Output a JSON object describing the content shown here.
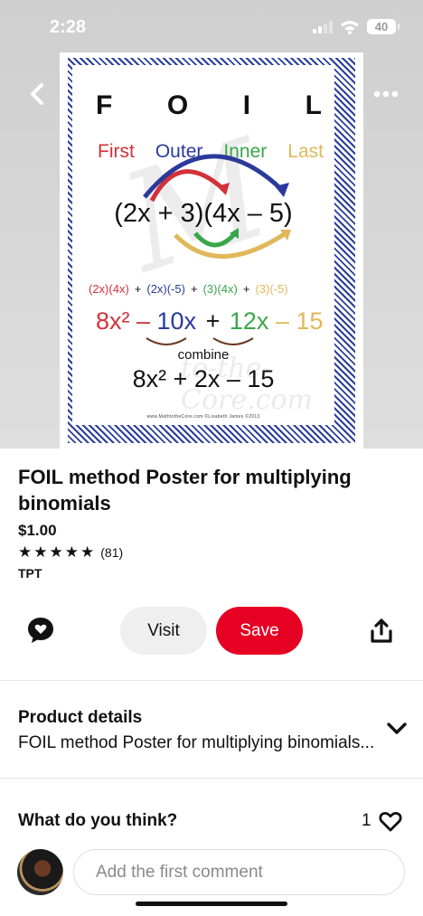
{
  "status_bar": {
    "time": "2:28",
    "battery": "40"
  },
  "poster": {
    "letters": [
      "F",
      "O",
      "I",
      "L"
    ],
    "words": [
      "First",
      "Outer",
      "Inner",
      "Last"
    ],
    "expression": "(2x + 3)(4x – 5)",
    "expansion": [
      "(2x)(4x)",
      "+",
      "(2x)(-5)",
      "+",
      "(3)(4x)",
      "+",
      "(3)(-5)"
    ],
    "terms": [
      "8x² – ",
      "10x",
      " + ",
      "12x",
      " – ",
      "15"
    ],
    "combine_label": "combine",
    "result": "8x² + 2x – 15",
    "credit": "www.MathtotheCore.com   ©Lisabeth James ©2013"
  },
  "pin": {
    "title": "FOIL method Poster for multiplying binomials",
    "price": "$1.00",
    "rating_count": "(81)",
    "stars": 5,
    "store": "TPT"
  },
  "actions": {
    "visit_label": "Visit",
    "save_label": "Save"
  },
  "product_details": {
    "heading": "Product details",
    "description": "FOIL method Poster for multiplying binomials..."
  },
  "comments": {
    "prompt": "What do you think?",
    "like_count": "1",
    "input_placeholder": "Add the first comment"
  },
  "colors": {
    "save": "#e60023",
    "visit": "#efefef",
    "poster_border": "#2a3e99"
  }
}
